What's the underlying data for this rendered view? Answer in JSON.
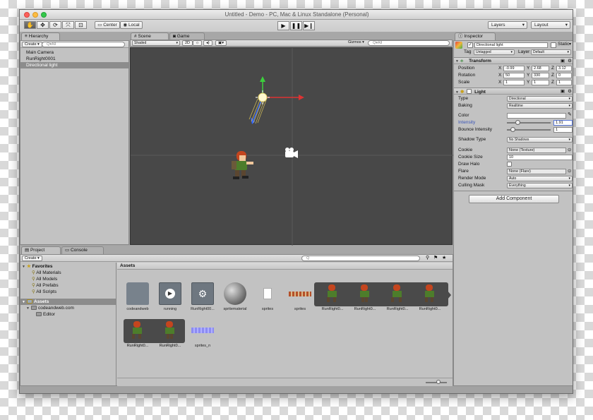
{
  "window": {
    "title": "Untitled - Demo - PC, Mac & Linux Standalone (Personal)"
  },
  "toolbar": {
    "tools": [
      "hand-icon",
      "move-icon",
      "rotate-icon",
      "scale-icon",
      "rect-icon"
    ],
    "pivot_label": "Center",
    "space_label": "Local",
    "layers_label": "Layers",
    "layout_label": "Layout"
  },
  "hierarchy": {
    "tab": "Hierarchy",
    "create_label": "Create ▾",
    "search_placeholder": "Q▾All",
    "items": [
      "Main Camera",
      "RunRight0001",
      "Directional light"
    ],
    "selected_index": 2
  },
  "scene": {
    "tabs": [
      "Scene",
      "Game"
    ],
    "shading": "Shaded",
    "mode_2d": "2D",
    "gizmos": "Gizmos ▾",
    "search_placeholder": "Q▾All",
    "background": "#484848"
  },
  "inspector": {
    "tab": "Inspector",
    "object_name": "Directional light",
    "static_label": "Static",
    "tag_label": "Tag",
    "tag_value": "Untagged",
    "layer_label": "Layer",
    "layer_value": "Default",
    "transform": {
      "title": "Transform",
      "position_label": "Position",
      "position": {
        "x": "-0.99",
        "y": "2.68",
        "z": "3.12"
      },
      "rotation_label": "Rotation",
      "rotation": {
        "x": "50",
        "y": "330",
        "z": "0"
      },
      "scale_label": "Scale",
      "scale": {
        "x": "1",
        "y": "1",
        "z": "1"
      }
    },
    "light": {
      "title": "Light",
      "type_label": "Type",
      "type_value": "Directional",
      "baking_label": "Baking",
      "baking_value": "Realtime",
      "color_label": "Color",
      "intensity_label": "Intensity",
      "intensity_value": "1.91",
      "intensity_fraction": 0.24,
      "bounce_label": "Bounce Intensity",
      "bounce_value": "1",
      "bounce_fraction": 0.125,
      "shadow_label": "Shadow Type",
      "shadow_value": "No Shadows",
      "cookie_label": "Cookie",
      "cookie_value": "None (Texture)",
      "cookie_size_label": "Cookie Size",
      "cookie_size_value": "10",
      "halo_label": "Draw Halo",
      "flare_label": "Flare",
      "flare_value": "None (Flare)",
      "render_mode_label": "Render Mode",
      "render_mode_value": "Auto",
      "culling_label": "Culling Mask",
      "culling_value": "Everything"
    },
    "add_component_label": "Add Component"
  },
  "project": {
    "tabs": [
      "Project",
      "Console"
    ],
    "create_label": "Create ▾",
    "favorites_label": "Favorites",
    "favorites": [
      "All Materials",
      "All Models",
      "All Prefabs",
      "All Scripts"
    ],
    "assets_root": "Assets",
    "tree": [
      "codeandweb.com",
      "Editor"
    ],
    "breadcrumb": "Assets",
    "assets": [
      {
        "name": "codeandweb",
        "icon": "folder-icon"
      },
      {
        "name": "running",
        "icon": "play-file-icon"
      },
      {
        "name": "RunRight00...",
        "icon": "prefab-icon"
      },
      {
        "name": "spritematerial",
        "icon": "material-sphere-icon"
      },
      {
        "name": "sprites",
        "icon": "text-file-icon"
      },
      {
        "name": "sprites",
        "icon": "sprite-sheet-icon"
      },
      {
        "name": "RunRight0...",
        "icon": "sprite-frame-icon"
      },
      {
        "name": "RunRight0...",
        "icon": "sprite-frame-icon"
      },
      {
        "name": "RunRight0...",
        "icon": "sprite-frame-icon"
      },
      {
        "name": "RunRight0...",
        "icon": "sprite-frame-icon"
      },
      {
        "name": "RunRight0...",
        "icon": "sprite-frame-icon"
      },
      {
        "name": "RunRight0...",
        "icon": "sprite-frame-icon"
      },
      {
        "name": "sprites_n",
        "icon": "normal-map-icon"
      }
    ]
  }
}
